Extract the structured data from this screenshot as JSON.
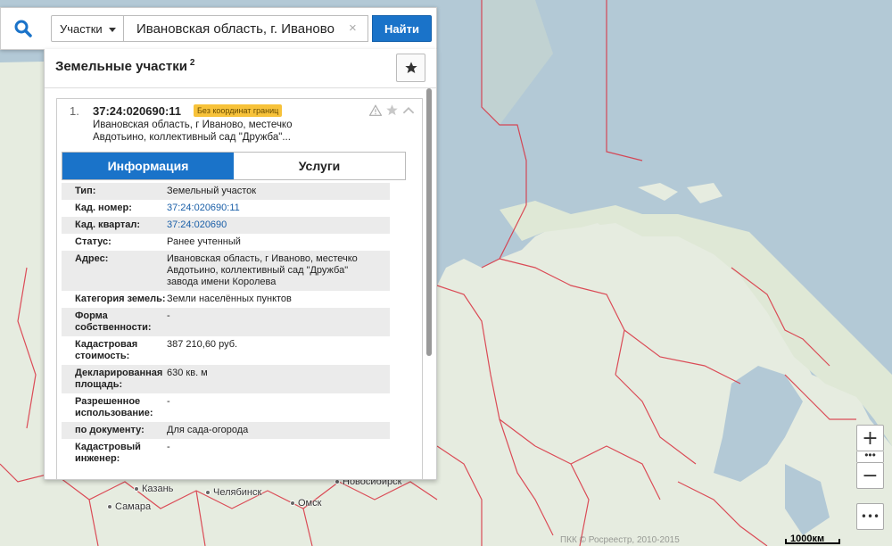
{
  "search": {
    "type_label": "Участки",
    "query": "Ивановская область, г. Иваново",
    "clear_symbol": "×",
    "find_label": "Найти"
  },
  "panel": {
    "title": "Земельные участки",
    "count": "2",
    "item": {
      "number": "1.",
      "cad_number": "37:24:020690:11",
      "badge": "Без координат границ",
      "address_short": "Ивановская область, г Иваново, местечко Авдотьино, коллективный сад \"Дружба\"...",
      "tabs": [
        {
          "label": "Информация",
          "active": true
        },
        {
          "label": "Услуги",
          "active": false
        }
      ],
      "rows": [
        {
          "label": "Тип:",
          "value": "Земельный участок"
        },
        {
          "label": "Кад. номер:",
          "value": "37:24:020690:11",
          "link": true
        },
        {
          "label": "Кад. квартал:",
          "value": "37:24:020690",
          "link": true
        },
        {
          "label": "Статус:",
          "value": "Ранее учтенный"
        },
        {
          "label": "Адрес:",
          "value": "Ивановская область, г Иваново, местечко Авдотьино, коллективный сад \"Дружба\" завода имени Королева"
        },
        {
          "label": "Категория земель:",
          "value": "Земли населённых пунктов"
        },
        {
          "label": "Форма собственности:",
          "value": "-"
        },
        {
          "label": "Кадастровая стоимость:",
          "value": "387 210,60 руб."
        },
        {
          "label": "Декларированная площадь:",
          "value": "630 кв. м"
        },
        {
          "label": "Разрешенное использование:",
          "value": "-"
        },
        {
          "label": "по документу:",
          "value": "Для сада-огорода"
        },
        {
          "label": "Кадастровый инженер:",
          "value": "-"
        }
      ]
    }
  },
  "map": {
    "cities": [
      "Казань",
      "Самара",
      "Челябинск",
      "Омск",
      "Новосибирск"
    ],
    "scale_label": "1000км",
    "copyright": "ПКК © Росреестр, 2010-2015"
  },
  "zoom": {
    "plus": "+",
    "minus": "−",
    "dots": "•••"
  }
}
